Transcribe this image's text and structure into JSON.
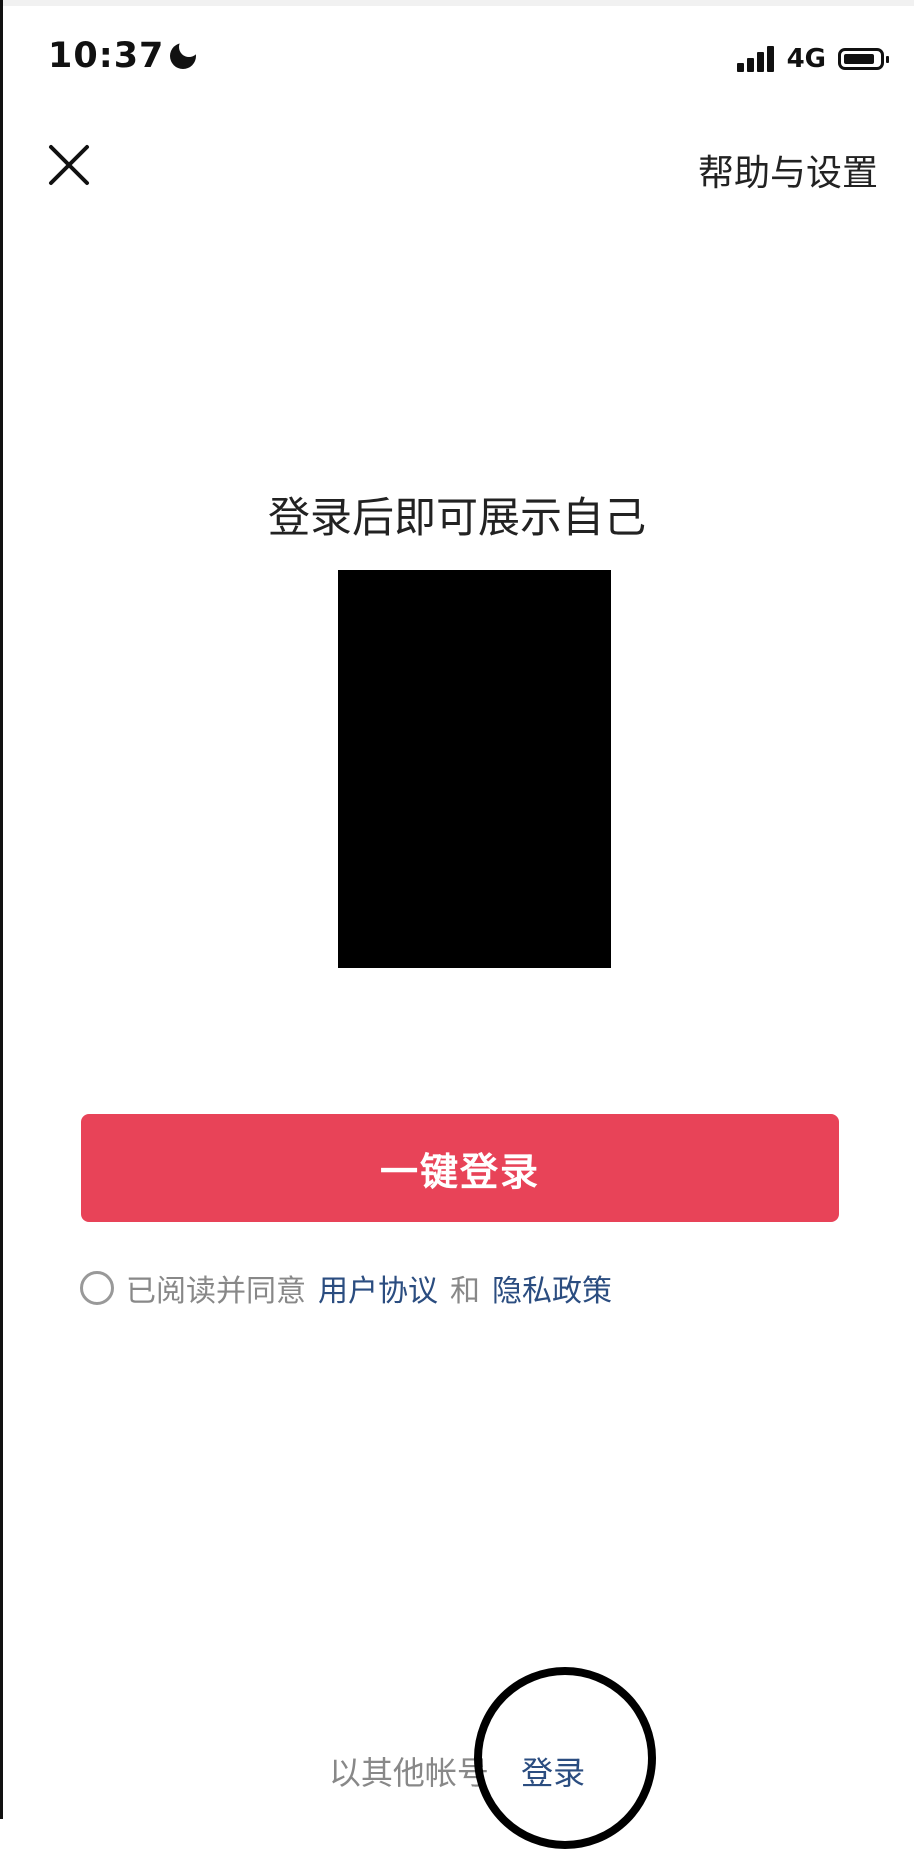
{
  "status_bar": {
    "time": "10:37",
    "network": "4G",
    "icons": [
      "moon-icon",
      "signal-icon",
      "battery-icon"
    ]
  },
  "header": {
    "close_icon": "close-icon",
    "help_label": "帮助与设置"
  },
  "main": {
    "title": "登录后即可展示自己",
    "login_button_label": "一键登录",
    "agreement": {
      "prefix": "已阅读并同意",
      "user_agreement": "用户协议",
      "and": "和",
      "privacy_policy": "隐私政策"
    }
  },
  "footer": {
    "prefix": "以其他帐号",
    "login_link": "登录"
  },
  "colors": {
    "accent": "#e84358",
    "link": "#2b4d80",
    "muted": "#888888"
  }
}
